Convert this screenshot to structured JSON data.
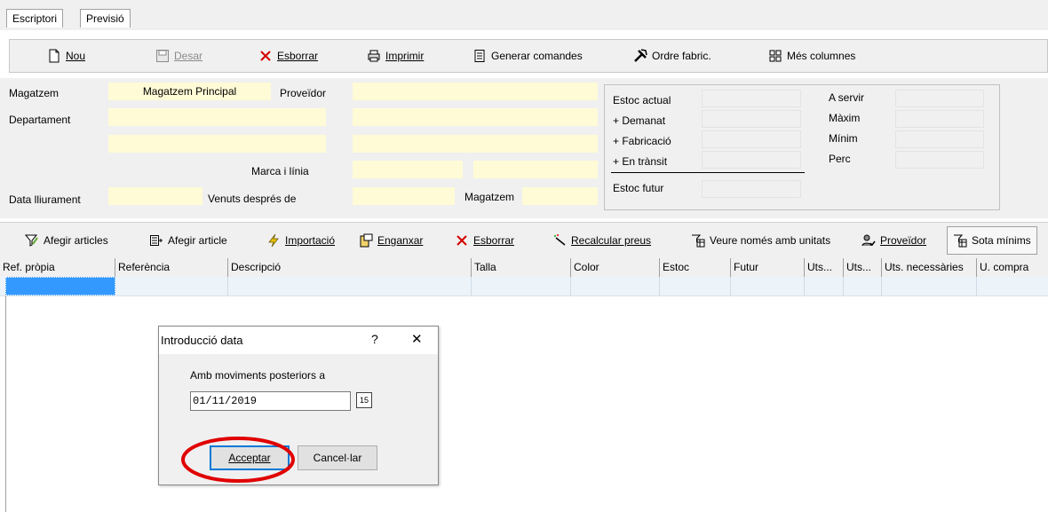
{
  "tabs": [
    "Escriptori",
    "Previsió"
  ],
  "toolbar": {
    "nou": "Nou",
    "desar": "Desar",
    "esborrar": "Esborrar",
    "imprimir": "Imprimir",
    "generar": "Generar comandes",
    "ordre": "Ordre fabric.",
    "mes_columnes": "Més columnes"
  },
  "form": {
    "magatzem_label": "Magatzem",
    "magatzem_value": "Magatzem Principal",
    "proveidor_label": "Proveïdor",
    "departament_label": "Departament",
    "marca_label": "Marca i línia",
    "data_lliurament_label": "Data lliurament",
    "venuts_label": "Venuts després de",
    "magatzem2_label": "Magatzem"
  },
  "estoc": {
    "actual": "Estoc actual",
    "demanat": "+ Demanat",
    "fabricacio": "+ Fabricació",
    "transit": "+ En trànsit",
    "futur": "Estoc futur",
    "a_servir": "A servir",
    "maxim": "Màxim",
    "minim": "Mínim",
    "perc": "Perc"
  },
  "toolbar2": {
    "afegir_articles": "Afegir articles",
    "afegir_article": "Afegir article",
    "importacio": "Importació",
    "enganxar": "Enganxar",
    "esborrar": "Esborrar",
    "recalcular": "Recalcular preus",
    "veure": "Veure només amb unitats",
    "proveidor": "Proveïdor",
    "sota": "Sota mínims"
  },
  "grid": {
    "columns": [
      "Ref. pròpia",
      "Referència",
      "Descripció",
      "Talla",
      "Color",
      "Estoc",
      "Futur",
      "Uts...",
      "Uts...",
      "Uts. necessàries",
      "U. compra"
    ]
  },
  "dialog": {
    "title": "Introducció data",
    "help": "?",
    "close": "✕",
    "prompt": "Amb moviments posteriors a",
    "date_value": "01/11/2019",
    "calendar": "15",
    "accept": "Acceptar",
    "cancel": "Cancel·lar"
  },
  "colors": {
    "field_yellow": "#fffbd6",
    "selected_cell": "#3399ff",
    "highlight_ring": "#e00000"
  }
}
